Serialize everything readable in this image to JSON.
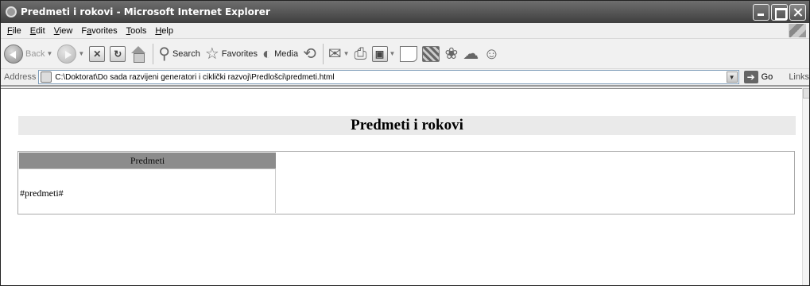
{
  "window": {
    "title": "Predmeti i rokovi - Microsoft Internet Explorer"
  },
  "menu": {
    "items": [
      {
        "label": "File",
        "key": "F",
        "rest": "ile"
      },
      {
        "label": "Edit",
        "key": "E",
        "rest": "dit"
      },
      {
        "label": "View",
        "key": "V",
        "rest": "iew"
      },
      {
        "label": "Favorites",
        "key": "a",
        "pre": "F",
        "rest": "vorites"
      },
      {
        "label": "Tools",
        "key": "T",
        "rest": "ools"
      },
      {
        "label": "Help",
        "key": "H",
        "rest": "elp"
      }
    ]
  },
  "toolbar": {
    "back_label": "Back",
    "search_label": "Search",
    "favorites_label": "Favorites",
    "media_label": "Media"
  },
  "address": {
    "label": "Address",
    "value": "C:\\Doktorat\\Do sada razvijeni generatori i ciklički razvoj\\Predlošci\\predmeti.html",
    "go_label": "Go",
    "links_label": "Links"
  },
  "page": {
    "heading": "Predmeti i rokovi",
    "table": {
      "header": "Predmeti",
      "cell": "#predmeti#"
    }
  }
}
